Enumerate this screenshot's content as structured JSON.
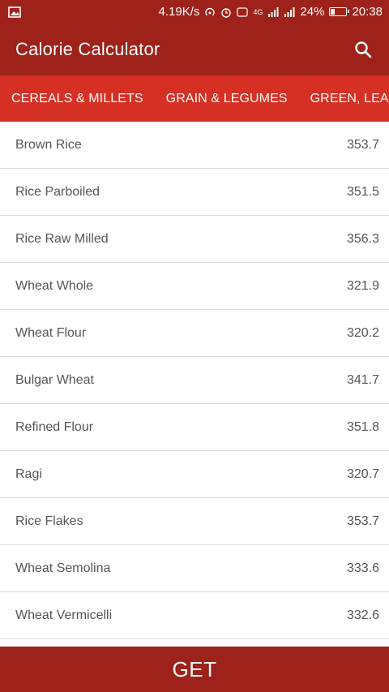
{
  "status": {
    "speed": "4.19K/s",
    "network": "4G",
    "battery": "24%",
    "battery_level": 0.24,
    "time": "20:38"
  },
  "header": {
    "title": "Calorie Calculator",
    "search_icon": "search-icon"
  },
  "tabs": [
    {
      "label": "CEREALS & MILLETS"
    },
    {
      "label": "GRAIN & LEGUMES"
    },
    {
      "label": "GREEN, LEAFY &"
    }
  ],
  "items": [
    {
      "name": "Brown Rice",
      "value": "353.7"
    },
    {
      "name": "Rice Parboiled",
      "value": "351.5"
    },
    {
      "name": "Rice Raw Milled",
      "value": "356.3"
    },
    {
      "name": "Wheat Whole",
      "value": "321.9"
    },
    {
      "name": "Wheat Flour",
      "value": "320.2"
    },
    {
      "name": "Bulgar Wheat",
      "value": "341.7"
    },
    {
      "name": "Refined Flour",
      "value": "351.8"
    },
    {
      "name": "Ragi",
      "value": "320.7"
    },
    {
      "name": "Rice Flakes",
      "value": "353.7"
    },
    {
      "name": "Wheat Semolina",
      "value": "333.6"
    },
    {
      "name": "Wheat Vermicelli",
      "value": "332.6"
    }
  ],
  "footer": {
    "button_label": "GET"
  },
  "colors": {
    "appbar": "#9e2219",
    "tabs": "#d63024",
    "text": "#555555"
  }
}
